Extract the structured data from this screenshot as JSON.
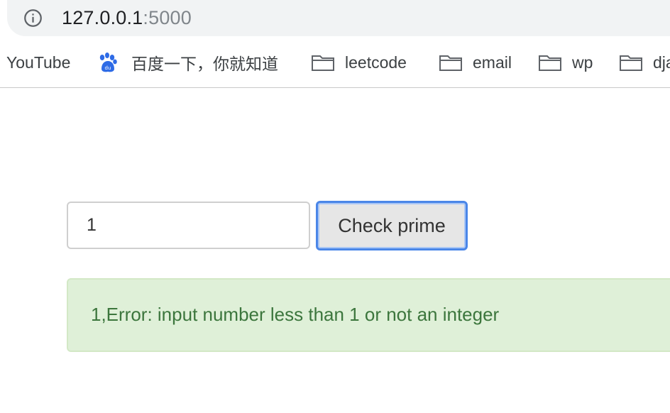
{
  "browser": {
    "url_host": "127.0.0.1",
    "url_port": ":5000",
    "bookmarks": [
      {
        "label": "YouTube",
        "icon": "none"
      },
      {
        "label": "百度一下，你就知道",
        "icon": "baidu-paw-icon"
      },
      {
        "label": "leetcode",
        "icon": "folder-icon"
      },
      {
        "label": "email",
        "icon": "folder-icon"
      },
      {
        "label": "wp",
        "icon": "folder-icon"
      },
      {
        "label": "dja",
        "icon": "folder-icon"
      }
    ]
  },
  "form": {
    "input_value": "1",
    "button_label": "Check prime"
  },
  "result": {
    "message": "1,Error: input number less than 1 or not an integer"
  },
  "colors": {
    "alert_bg": "#dff0d8",
    "alert_text": "#3c763d",
    "focus_ring": "#4a86e8",
    "baidu_blue": "#2e6be6"
  }
}
